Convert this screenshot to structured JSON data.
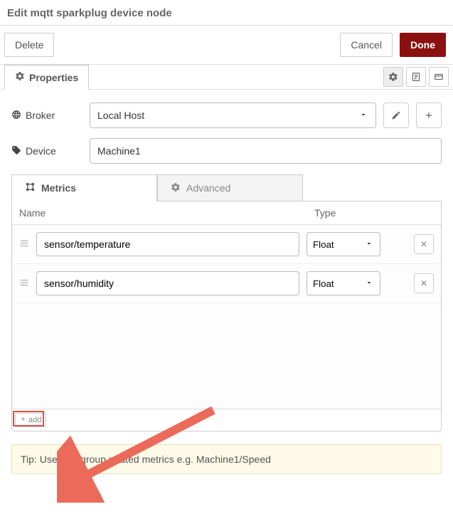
{
  "title": "Edit mqtt sparkplug device node",
  "buttons": {
    "delete": "Delete",
    "cancel": "Cancel",
    "done": "Done"
  },
  "tabs": {
    "properties": "Properties"
  },
  "form": {
    "broker_label": "Broker",
    "broker_value": "Local Host",
    "device_label": "Device",
    "device_value": "Machine1"
  },
  "sub_tabs": {
    "metrics": "Metrics",
    "advanced": "Advanced"
  },
  "metrics": {
    "columns": {
      "name": "Name",
      "type": "Type"
    },
    "rows": [
      {
        "name": "sensor/temperature",
        "type": "Float"
      },
      {
        "name": "sensor/humidity",
        "type": "Float"
      }
    ],
    "add_label": "add"
  },
  "tip": "Tip: Use '/' to group related metrics e.g. Machine1/Speed"
}
